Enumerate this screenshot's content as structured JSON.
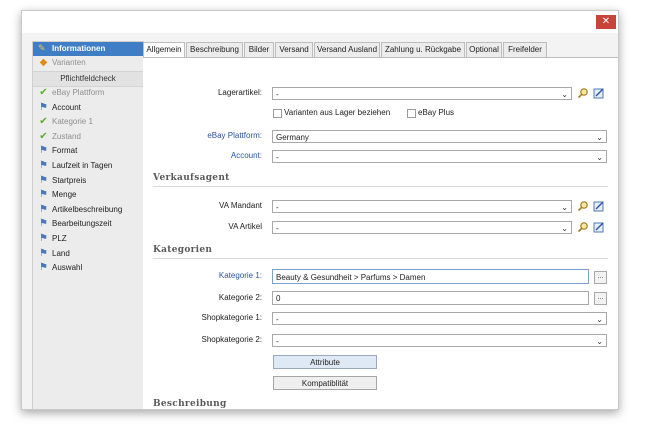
{
  "window": {
    "close_glyph": "✕"
  },
  "sidebar": {
    "header": "Informationen",
    "item_varianten": "Varianten",
    "section_label": "Pflichtfeldcheck",
    "items": [
      {
        "label": "eBay Plattform",
        "state": "done"
      },
      {
        "label": "Account",
        "state": "todo"
      },
      {
        "label": "Kategorie 1",
        "state": "done"
      },
      {
        "label": "Zustand",
        "state": "done"
      },
      {
        "label": "Format",
        "state": "todo"
      },
      {
        "label": "Laufzeit in Tagen",
        "state": "todo"
      },
      {
        "label": "Startpreis",
        "state": "todo"
      },
      {
        "label": "Menge",
        "state": "todo"
      },
      {
        "label": "Artikelbeschreibung",
        "state": "todo"
      },
      {
        "label": "Bearbeitungszeit",
        "state": "todo"
      },
      {
        "label": "PLZ",
        "state": "todo"
      },
      {
        "label": "Land",
        "state": "todo"
      },
      {
        "label": "Auswahl",
        "state": "todo"
      }
    ]
  },
  "tabs": [
    "Allgemein",
    "Beschreibung",
    "Bilder",
    "Versand",
    "Versand Ausland",
    "Zahlung u. Rückgabe",
    "Optional",
    "Freifelder"
  ],
  "active_tab": "Allgemein",
  "form": {
    "lagerartikel": {
      "label": "Lagerartikel:",
      "value": "-"
    },
    "varianten_check": "Varianten aus Lager beziehen",
    "ebay_plus_check": "eBay Plus",
    "plattform": {
      "label": "eBay Plattform:",
      "value": "Germany"
    },
    "account": {
      "label": "Account:",
      "value": "-"
    },
    "verkaufsagent_title": "Verkaufsagent",
    "va_mandant": {
      "label": "VA Mandant",
      "value": "-"
    },
    "va_artikel": {
      "label": "VA Artikel",
      "value": "-"
    },
    "kategorien_title": "Kategorien",
    "kategorie1": {
      "label": "Kategorie 1:",
      "value": "Beauty & Gesundheit > Parfums > Damen"
    },
    "kategorie2": {
      "label": "Kategorie 2:",
      "value": "0"
    },
    "shopkategorie1": {
      "label": "Shopkategorie 1:",
      "value": "-"
    },
    "shopkategorie2": {
      "label": "Shopkategorie 2:",
      "value": "-"
    },
    "attribute_button": "Attribute",
    "kompatibilitaet_button": "Kompatiblität",
    "beschreibung_title": "Beschreibung",
    "ellipsis": "..."
  },
  "colors": {
    "sidebar_header": "#3f7dc4",
    "close_button": "#c9433a",
    "label_blue": "#2b54a3"
  },
  "icons": {
    "search": "search-icon",
    "edit": "edit-icon",
    "check": "check-icon",
    "flag": "flag-icon",
    "warning": "wrench-icon"
  }
}
